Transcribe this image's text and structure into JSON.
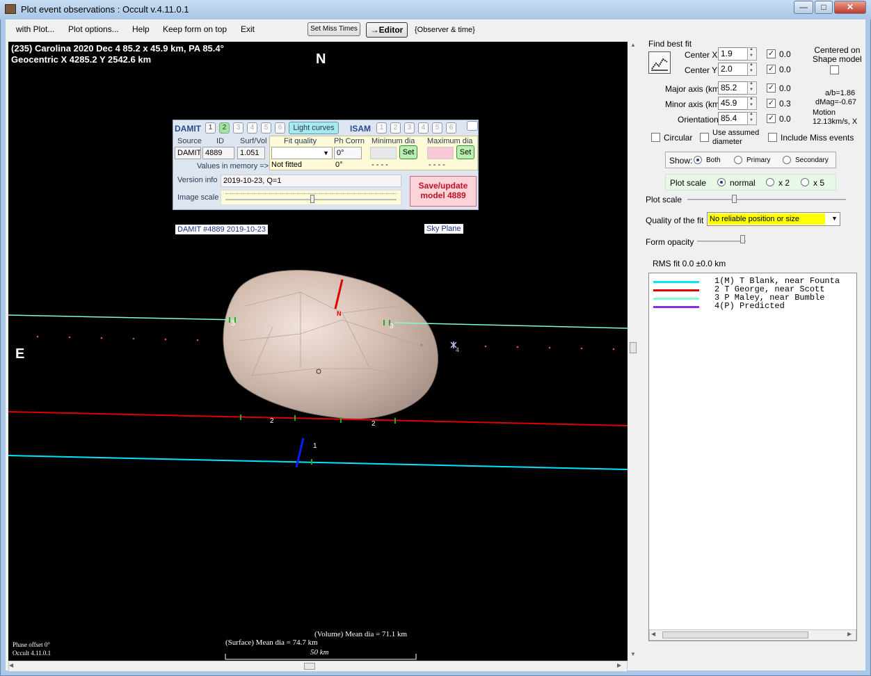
{
  "window": {
    "title": "Plot event observations : Occult v.4.11.0.1",
    "controls": [
      "—",
      "□",
      "✕"
    ]
  },
  "menu": {
    "items": [
      "with Plot...",
      "Plot options...",
      "Help",
      "Keep form on top",
      "Exit"
    ],
    "set_miss_times": "Set Miss Times",
    "editor": "→Editor",
    "observer_time": "{Observer & time}"
  },
  "plot": {
    "header_line1": "(235) Carolina  2020 Dec 4  85.2 x 45.9 km,  PA 85.4°",
    "header_line2": "Geocentric  X  4285.2  Y  2542.6 km",
    "north": "N",
    "east": "E",
    "model_label": "DAMIT #4889 2019-10-23",
    "sky_plane": "Sky Plane",
    "phase_offset": "Phase offset 0°",
    "occult_version": "Occult 4.11.0.1",
    "volume_mean": "(Volume) Mean dia = 71.1 km",
    "surface_mean": "(Surface) Mean dia = 74.7 km",
    "scale_bar": "50 km",
    "chord_labels": [
      "1",
      "2",
      "2",
      "3",
      "3",
      "4"
    ],
    "pole_label": "N",
    "colors": {
      "chord1": "#00e5ff",
      "chord2": "#e00000",
      "chord3": "#7fffd4",
      "predicted": "#e05070",
      "shape": "#cbb2a6"
    }
  },
  "damit_panel": {
    "damit_label": "DAMIT",
    "isam_label": "ISAM",
    "damit_nums": [
      "1",
      "2",
      "3",
      "4",
      "5",
      "6"
    ],
    "isam_nums": [
      "1",
      "2",
      "3",
      "4",
      "5",
      "6"
    ],
    "light_curves": "Light curves",
    "headers": {
      "source": "Source",
      "id": "ID",
      "surf_vol": "Surf/Vol",
      "fit_quality": "Fit quality",
      "ph_corrn": "Ph Corrn",
      "min_dia": "Minimum dia",
      "max_dia": "Maximum dia"
    },
    "source": "DAMIT",
    "id": "4889",
    "surf_vol": "1.051",
    "ph_corrn": "0°",
    "ph_corrn_mem": "0°",
    "values_in_memory": "Values in memory =>",
    "not_fitted": "Not fitted",
    "dashes_min": "- - - -",
    "dashes_max": "- - - -",
    "set": "Set",
    "version_info_label": "Version info",
    "version_info": "2019-10-23, Q=1",
    "image_scale": "Image scale",
    "save_line1": "Save/update",
    "save_line2": "model 4889"
  },
  "right_panel": {
    "find_best_fit": "Find best fit",
    "center_x_label": "Center X",
    "center_x": "1.9",
    "center_x_unc": "0.0",
    "center_y_label": "Center Y",
    "center_y": "2.0",
    "center_y_unc": "0.0",
    "centered_on_shape": "Centered on\nShape model",
    "major_label": "Major axis (km)",
    "major": "85.2",
    "major_unc": "0.0",
    "minor_label": "Minor axis (km)",
    "minor": "45.9",
    "minor_unc": "0.3",
    "orient_label": "Orientation",
    "orient": "85.4",
    "orient_unc": "0.0",
    "ab_ratio": "a/b=1.86",
    "dmag": "dMag=-0.67",
    "motion_label": "Motion",
    "motion": "12.13km/s, X",
    "circular": "Circular",
    "use_assumed": "Use assumed\ndiameter",
    "include_miss": "Include Miss events",
    "show_label": "Show:",
    "show_both": "Both",
    "show_primary": "Primary",
    "show_secondary": "Secondary",
    "plot_scale_label": "Plot scale",
    "scale_normal": "normal",
    "scale_x2": "x 2",
    "scale_x5": "x 5",
    "plot_scale_slider": "Plot scale",
    "quality_label": "Quality of the fit",
    "quality_value": "No reliable position or size",
    "form_opacity": "Form opacity",
    "rms_fit": "RMS fit 0.0 ±0.0 km",
    "legend": [
      {
        "color": "#00e5ff",
        "text": "1(M)  T Blank, near Founta"
      },
      {
        "color": "#e00000",
        "text": "2     T George, near Scott"
      },
      {
        "color": "#7fffd4",
        "text": "3     P Maley, near Bumble"
      },
      {
        "color": "#8a2be2",
        "text": "4(P)  Predicted"
      }
    ]
  }
}
